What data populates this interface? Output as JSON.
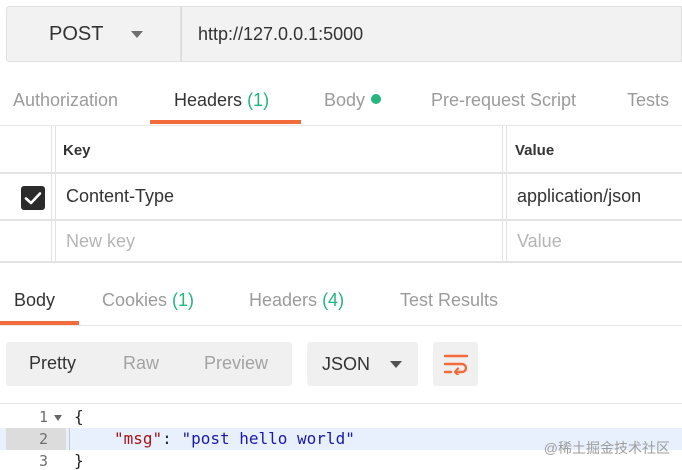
{
  "request": {
    "method": "POST",
    "url": "http://127.0.0.1:5000"
  },
  "request_tabs": [
    {
      "label": "Authorization"
    },
    {
      "label": "Headers",
      "count": "(1)"
    },
    {
      "label": "Body"
    },
    {
      "label": "Pre-request Script"
    },
    {
      "label": "Tests"
    }
  ],
  "headers_table": {
    "columns": [
      "Key",
      "Value"
    ],
    "rows": [
      {
        "key": "Content-Type",
        "value": "application/json",
        "checked": true
      }
    ],
    "new_row": {
      "key_placeholder": "New key",
      "value_placeholder": "Value"
    }
  },
  "response_tabs": [
    {
      "label": "Body"
    },
    {
      "label": "Cookies",
      "count": "(1)"
    },
    {
      "label": "Headers",
      "count": "(4)"
    },
    {
      "label": "Test Results"
    }
  ],
  "format_toolbar": {
    "modes": [
      "Pretty",
      "Raw",
      "Preview"
    ],
    "active_mode": "Pretty",
    "language": "JSON",
    "wrap_icon": "wrap-lines-icon"
  },
  "response_body": {
    "line_numbers": [
      "1",
      "2",
      "3"
    ],
    "line1": "{",
    "key": "\"msg\"",
    "colon": ": ",
    "value": "\"post hello world\"",
    "line3": "}"
  },
  "watermark": "@稀土掘金技术社区",
  "colors": {
    "accent": "#f26b3a",
    "count": "#26b47f"
  }
}
